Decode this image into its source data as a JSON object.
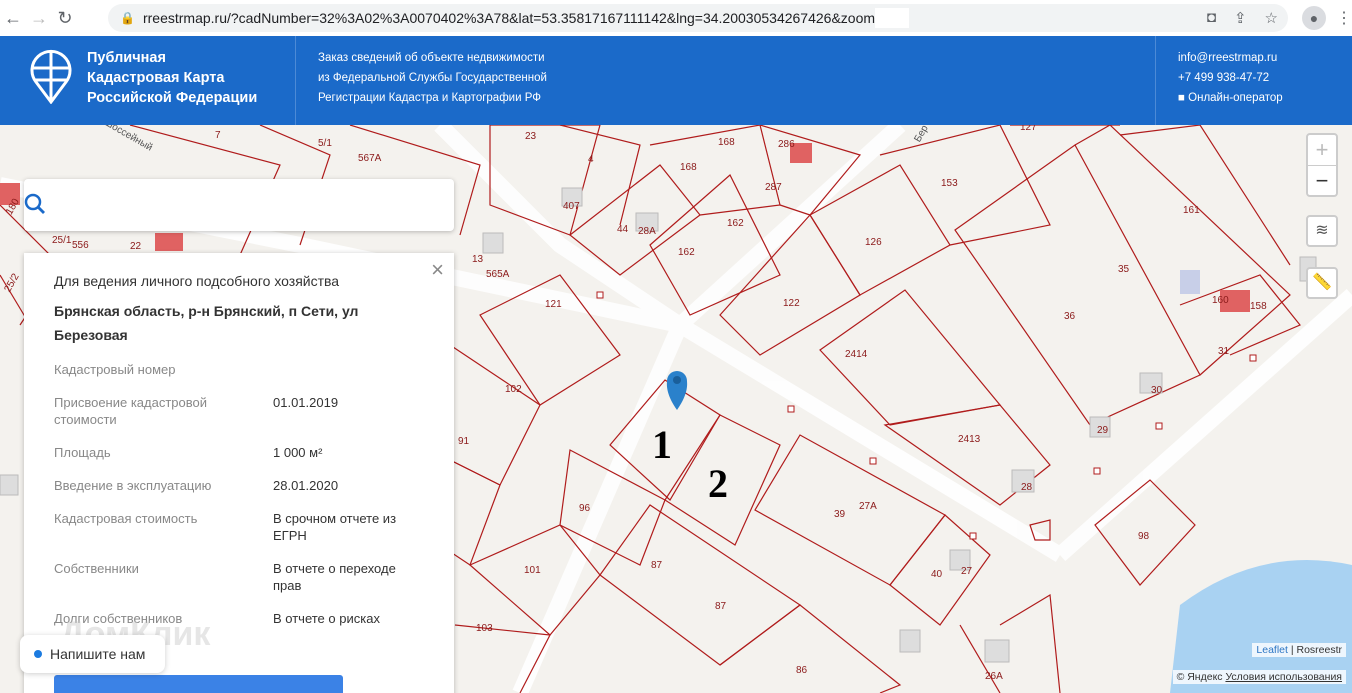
{
  "browser": {
    "url": "rreestrmap.ru/?cadNumber=32%3A02%3A0070402%3A78&lat=53.35817167111142&lng=34.20030534267426&zoom"
  },
  "header": {
    "brand_lines": [
      "Публичная",
      "Кадастровая Карта",
      "Российской Федерации"
    ],
    "info_lines": [
      "Заказ сведений об объекте недвижимости",
      "из Федеральной Службы Государственной",
      "Регистрации Кадастра и Картографии РФ"
    ],
    "email": "info@rreestrmap.ru",
    "phone": "+7 499 938-47-72",
    "operator": "Онлайн-оператор"
  },
  "search": {
    "placeholder": ""
  },
  "card": {
    "purpose": "Для ведения личного подсобного хозяйства",
    "address": "Брянская область, р-н Брянский, п Сети, ул Березовая",
    "rows": [
      {
        "k": "Кадастровый номер",
        "v": ""
      },
      {
        "k": "Присвоение кадастровой стоимости",
        "v": "01.01.2019"
      },
      {
        "k": "Площадь",
        "v": "1 000 м²"
      },
      {
        "k": "Введение в эксплуатацию",
        "v": "28.01.2020"
      },
      {
        "k": "Кадастровая стоимость",
        "v": "В срочном отчете из ЕГРН"
      },
      {
        "k": "Собственники",
        "v": "В отчете о переходе прав"
      },
      {
        "k": "Долги собственников",
        "v": "В отчете о рисках"
      }
    ]
  },
  "chat": {
    "label": "Напишите нам"
  },
  "watermark": "ДомКлик",
  "map": {
    "labels": [
      "7",
      "5/1",
      "567А",
      "23",
      "4",
      "168",
      "168",
      "286",
      "153",
      "127",
      "161",
      "407",
      "44",
      "28А",
      "162",
      "162",
      "287",
      "126",
      "35",
      "13",
      "565А",
      "121",
      "122",
      "2414",
      "36",
      "160",
      "158",
      "31",
      "30",
      "102",
      "91",
      "2413",
      "29",
      "28",
      "96",
      "39",
      "27А",
      "98",
      "101",
      "87",
      "87",
      "40",
      "27",
      "103",
      "86",
      "26А",
      "180",
      "25/1",
      "556",
      "22",
      "25/2"
    ],
    "streets": [
      "Шоссейный",
      "Бер"
    ],
    "markers": [
      "1",
      "2"
    ],
    "zoom_in": "+",
    "zoom_out": "−"
  },
  "attribution": {
    "leaflet": "Leaflet",
    "rosreestr": "Rosreestr",
    "yandex": "© Яндекс",
    "terms": "Условия использования"
  }
}
